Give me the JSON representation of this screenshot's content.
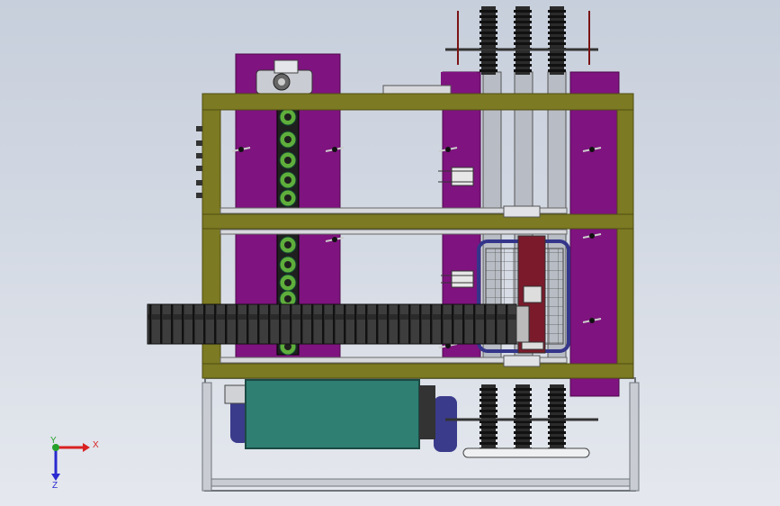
{
  "viewport": {
    "background_top": "#c7cfdc",
    "background_bottom": "#e5e8ee"
  },
  "colors": {
    "frame_olive": "#7c7a22",
    "frame_olive_dark": "#4f4d12",
    "purple_plate": "#7f137f",
    "purple_dark": "#4c0a4c",
    "chain_dark": "#2a2a2a",
    "teal_box": "#2f7f73",
    "rail_gray": "#b8bcc4",
    "gear_green": "#5fae3c",
    "motor_blue": "#3b3b8c",
    "basket_blue": "#34358a"
  },
  "triad": {
    "x_label": "X",
    "y_label": "Y",
    "z_label": "Z",
    "x_color": "#d92121",
    "y_color": "#25a02a",
    "z_color": "#2a2ad0"
  }
}
